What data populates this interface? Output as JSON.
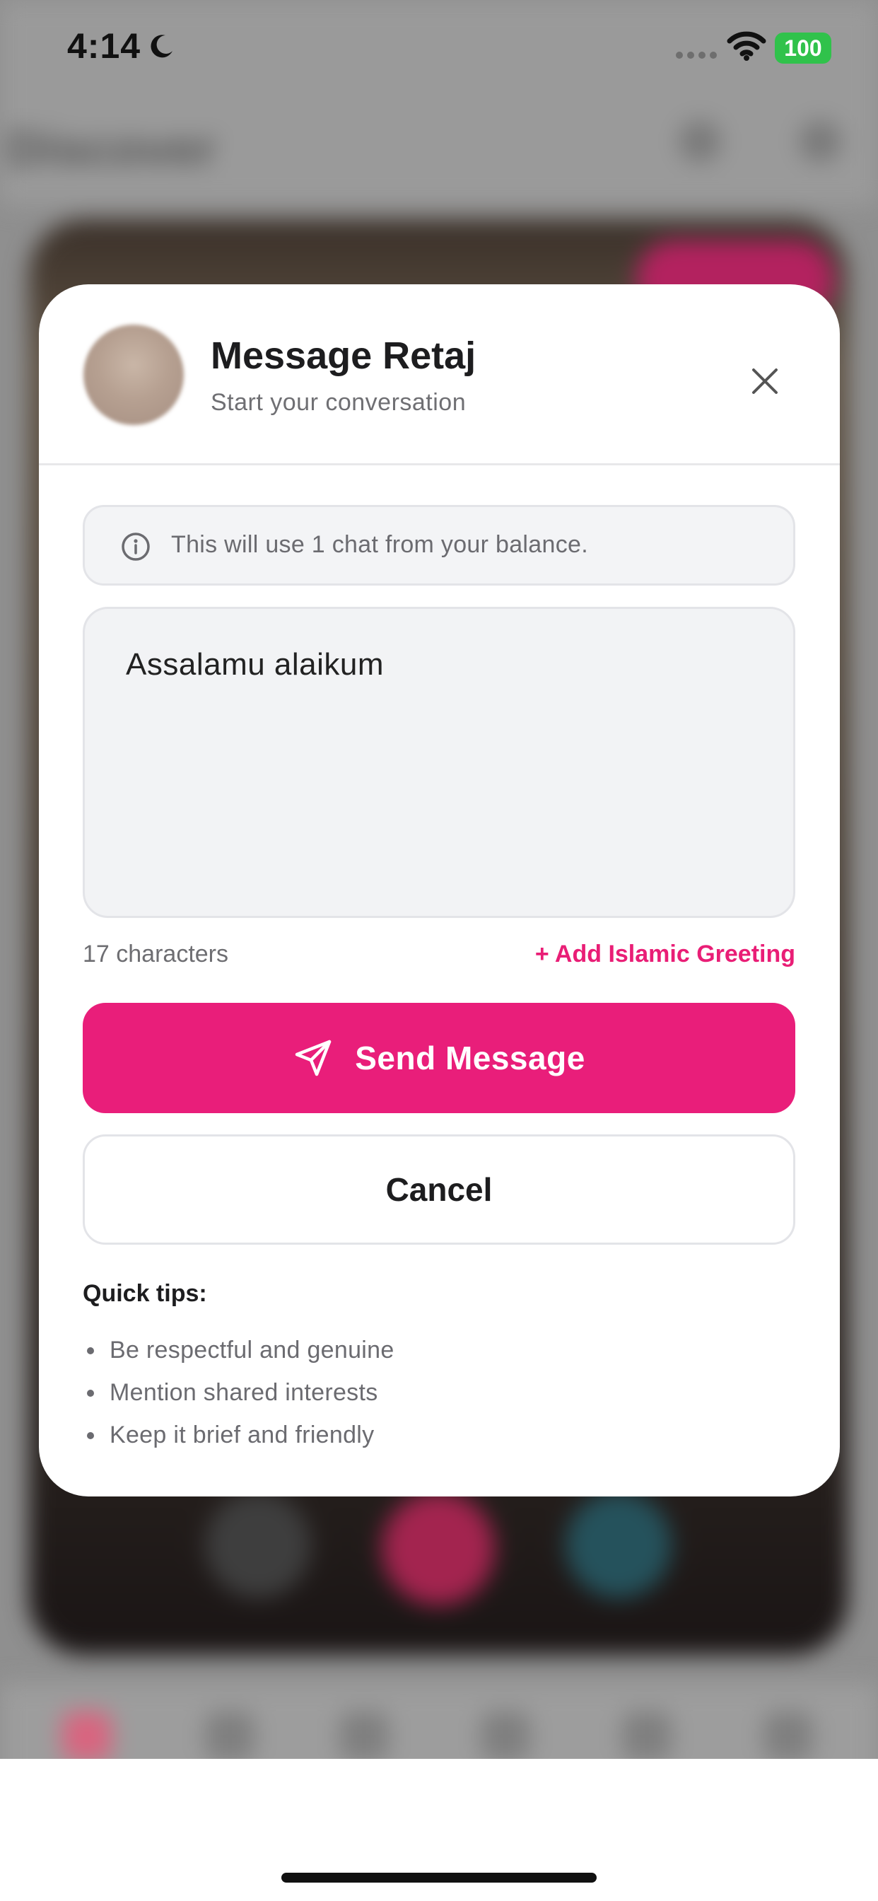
{
  "status_bar": {
    "time": "4:14",
    "battery": "100",
    "icons": [
      "moon-icon",
      "cellular-signal-icon",
      "wifi-icon"
    ],
    "battery_color": "#30c24b"
  },
  "modal": {
    "title": "Message Retaj",
    "subtitle": "Start your conversation",
    "close_icon": "close-icon",
    "info_icon": "info-icon",
    "info_text": "This will use 1 chat from your balance.",
    "message_value": "Assalamu alaikum",
    "char_count": "17 characters",
    "add_greeting_label": "+ Add Islamic Greeting",
    "send_label": "Send Message",
    "send_icon": "send-icon",
    "cancel_label": "Cancel",
    "tips_title": "Quick tips:",
    "tips": [
      "Be respectful and genuine",
      "Mention shared interests",
      "Keep it brief and friendly"
    ]
  },
  "colors": {
    "accent": "#e91e7a",
    "text_primary": "#1d1d1f",
    "text_secondary": "#6b6b70",
    "field_background": "#f2f3f5"
  }
}
